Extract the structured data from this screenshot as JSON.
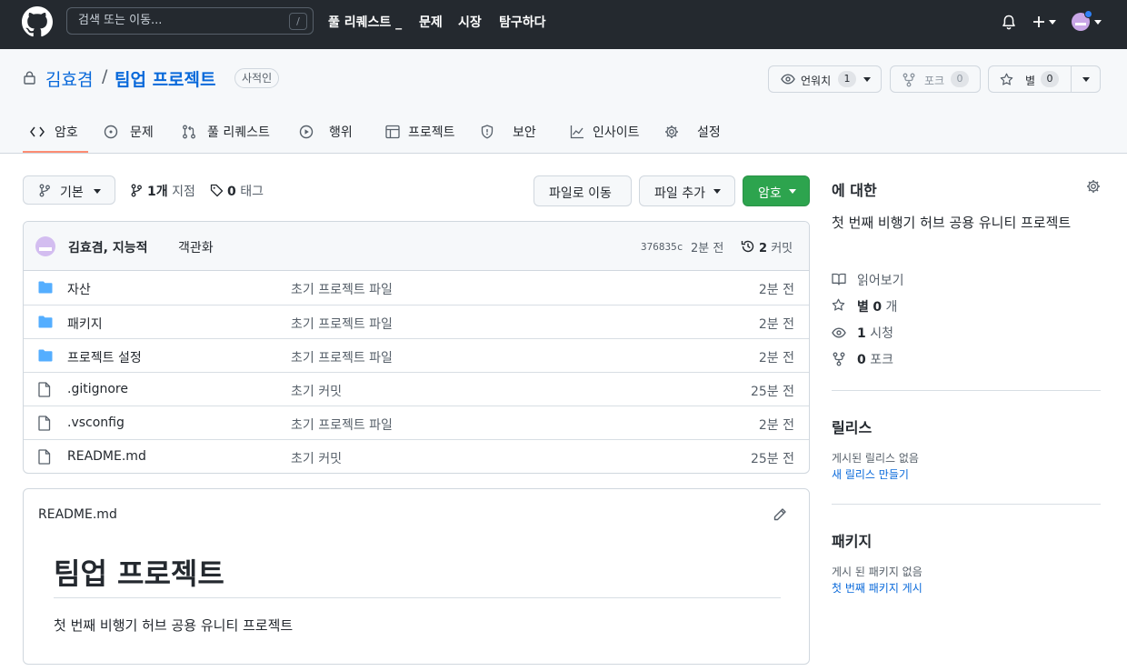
{
  "header": {
    "search_placeholder": "검색 또는 이동...",
    "search_shortcut": "/",
    "nav": [
      "풀 리퀘스트 _",
      "문제",
      "시장",
      "탐구하다"
    ]
  },
  "repo": {
    "owner": "김효겸",
    "separator": "/",
    "name": "팀업 프로젝트",
    "visibility": "사적인",
    "watch_label": "언워치",
    "watch_count": "1",
    "fork_label": "포크",
    "fork_count": "0",
    "star_label": "별",
    "star_count": "0"
  },
  "tabs": [
    {
      "label": "암호",
      "icon": "code-icon"
    },
    {
      "label": "문제",
      "icon": "issue-icon"
    },
    {
      "label": "풀 리퀘스트",
      "icon": "pull-request-icon"
    },
    {
      "label": "행위",
      "icon": "play-icon"
    },
    {
      "label": "프로젝트",
      "icon": "table-icon"
    },
    {
      "label": "보안",
      "icon": "shield-icon"
    },
    {
      "label": "인사이트",
      "icon": "graph-icon"
    },
    {
      "label": "설정",
      "icon": "gear-icon"
    }
  ],
  "toolbar": {
    "branch": "기본",
    "branches_count": "1개",
    "branches_label": "지점",
    "tags_count": "0",
    "tags_label": "태그",
    "goto_file": "파일로 이동",
    "add_file": "파일 추가",
    "code": "암호"
  },
  "commit": {
    "authors": "김효겸, 지능적",
    "message": "객관화",
    "sha": "376835c",
    "time": "2분 전",
    "commits_count": "2",
    "commits_label": "커밋"
  },
  "files": [
    {
      "name": "자산",
      "type": "folder",
      "message": "초기 프로젝트 파일",
      "age": "2분 전"
    },
    {
      "name": "패키지",
      "type": "folder",
      "message": "초기 프로젝트 파일",
      "age": "2분 전"
    },
    {
      "name": "프로젝트 설정",
      "type": "folder",
      "message": "초기 프로젝트 파일",
      "age": "2분 전"
    },
    {
      "name": ".gitignore",
      "type": "file",
      "message": "초기 커밋",
      "age": "25분 전"
    },
    {
      "name": ".vsconfig",
      "type": "file",
      "message": "초기 프로젝트 파일",
      "age": "2분 전"
    },
    {
      "name": "README.md",
      "type": "file",
      "message": "초기 커밋",
      "age": "25분 전"
    }
  ],
  "readme": {
    "filename": "README.md",
    "heading": "팀업 프로젝트",
    "body": "첫 번째 비행기 허브 공용 유니티 프로젝트"
  },
  "about": {
    "title": "에 대한",
    "description": "첫 번째 비행기 허브 공용 유니티 프로젝트",
    "readme": "읽어보기",
    "stars_label": "별",
    "stars_count": "0",
    "stars_unit": "개",
    "watching_count": "1",
    "watching_label": "시청",
    "forks_count": "0",
    "forks_label": "포크"
  },
  "releases": {
    "title": "릴리스",
    "none": "게시된 릴리스 없음",
    "create": "새 릴리스 만들기"
  },
  "packages": {
    "title": "패키지",
    "none": "게시 된 패키지 없음",
    "publish": "첫 번째 패키지 게시"
  },
  "colors": {
    "header_bg": "#24292f",
    "link": "#0969da",
    "primary_button": "#2da44e",
    "folder": "#54aeff",
    "tab_underline": "#fd8c73"
  }
}
